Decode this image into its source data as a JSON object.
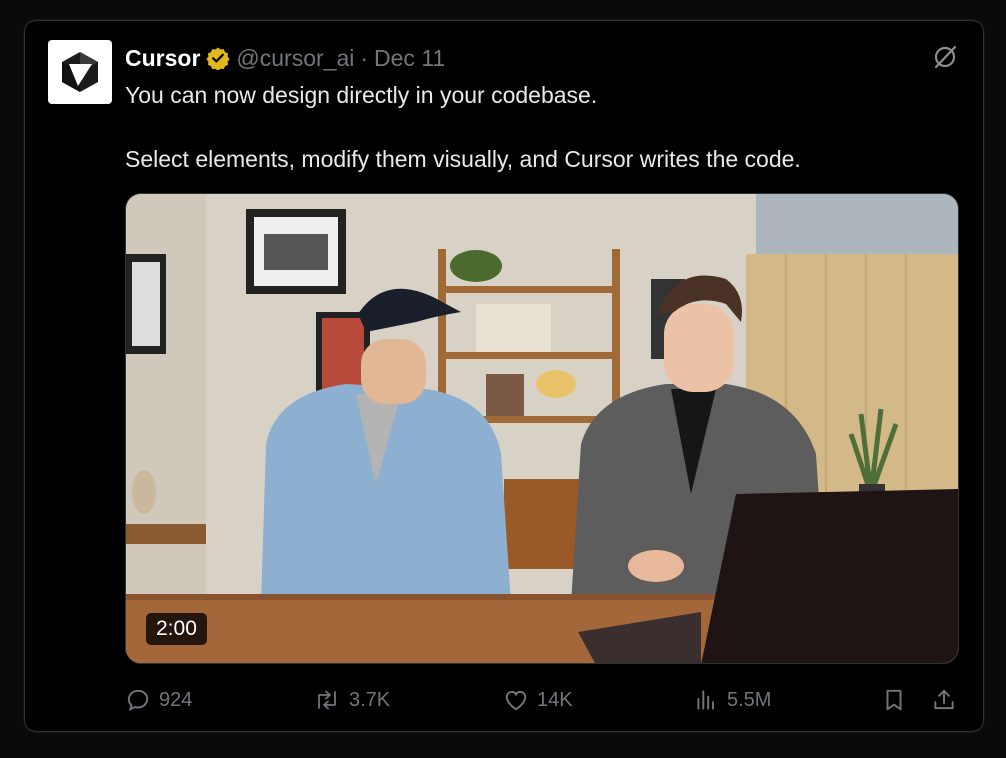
{
  "tweet": {
    "author_name": "Cursor",
    "handle": "@cursor_ai",
    "separator": "·",
    "date": "Dec 11",
    "text_line1": "You can now design directly in your codebase.",
    "text_line2": "Select elements, modify them visually, and Cursor writes the code."
  },
  "media": {
    "type": "video",
    "duration": "2:00"
  },
  "stats": {
    "replies": "924",
    "reposts": "3.7K",
    "likes": "14K",
    "views": "5.5M"
  },
  "icons": {
    "verified": "verified-badge-icon",
    "grok": "grok-icon",
    "reply": "reply-icon",
    "repost": "repost-icon",
    "like": "heart-icon",
    "views": "views-icon",
    "bookmark": "bookmark-icon",
    "share": "share-icon"
  },
  "colors": {
    "background": "#000000",
    "text": "#e7e9ea",
    "muted": "#71767b",
    "verified_gold": "#e2b719",
    "border": "#2f3336"
  }
}
